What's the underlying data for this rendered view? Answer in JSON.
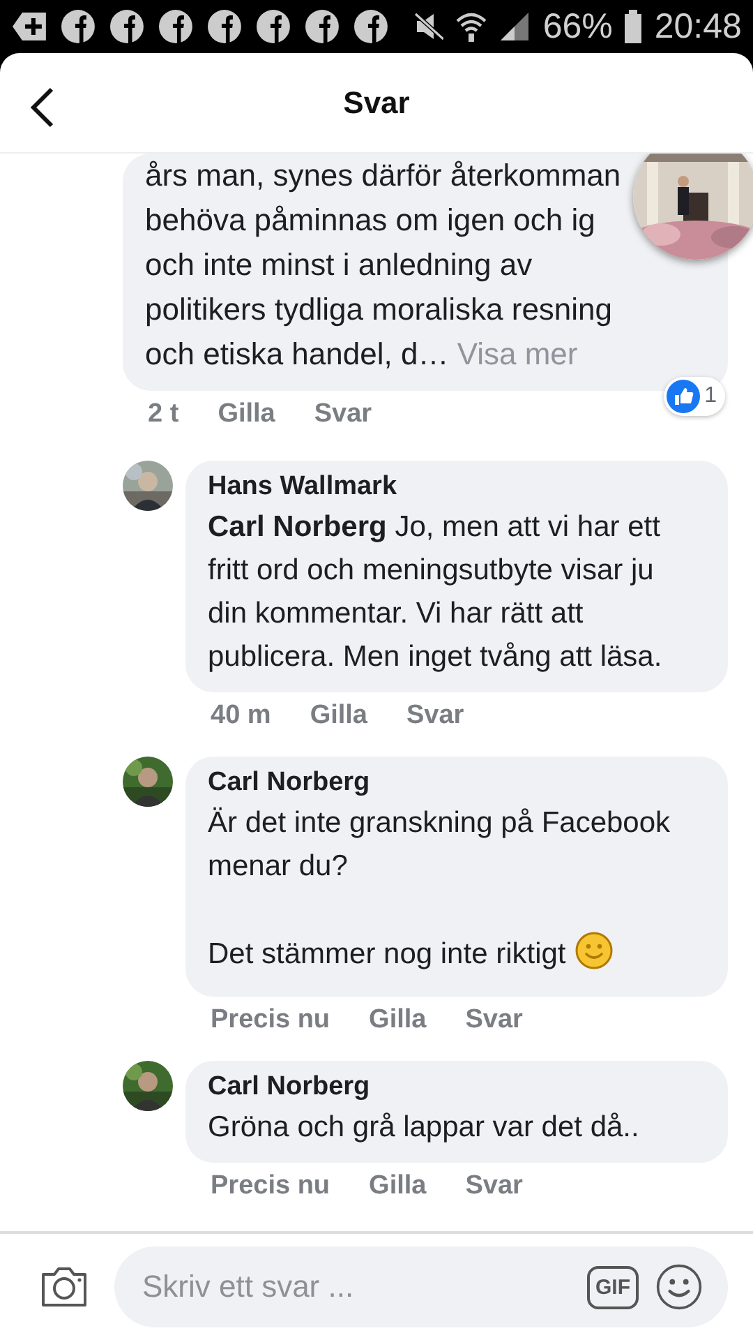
{
  "status_bar": {
    "battery": "66%",
    "time": "20:48"
  },
  "header": {
    "title": "Svar"
  },
  "thread": {
    "lines": [
      "års man, synes därför återkomman",
      "behöva påminnas om igen och ig",
      "och inte minst i anledning av",
      "politikers tydliga moraliska resning",
      "och etiska handel, d…"
    ],
    "more": "Visa mer",
    "time": "2 t",
    "like": "Gilla",
    "reply": "Svar",
    "reactions": "1"
  },
  "replies": [
    {
      "author": "Hans Wallmark",
      "text": "**Carl Norberg** Jo, men att vi har ett fritt ord och meningsutbyte visar ju din kommentar. Vi har rätt att publicera. Men inget tvång att läsa.",
      "emoji": false,
      "time": "40 m",
      "like": "Gilla",
      "reply": "Svar"
    },
    {
      "author": "Carl Norberg",
      "text": "Är det inte granskning på Facebook menar du?\n\nDet stämmer nog inte riktigt",
      "emoji": true,
      "time": "Precis nu",
      "like": "Gilla",
      "reply": "Svar"
    },
    {
      "author": "Carl Norberg",
      "text": "Gröna och grå lappar var det då..",
      "emoji": false,
      "time": "Precis nu",
      "like": "Gilla",
      "reply": "Svar"
    }
  ],
  "composer": {
    "placeholder": "Skriv ett svar ...",
    "gif": "GIF"
  }
}
